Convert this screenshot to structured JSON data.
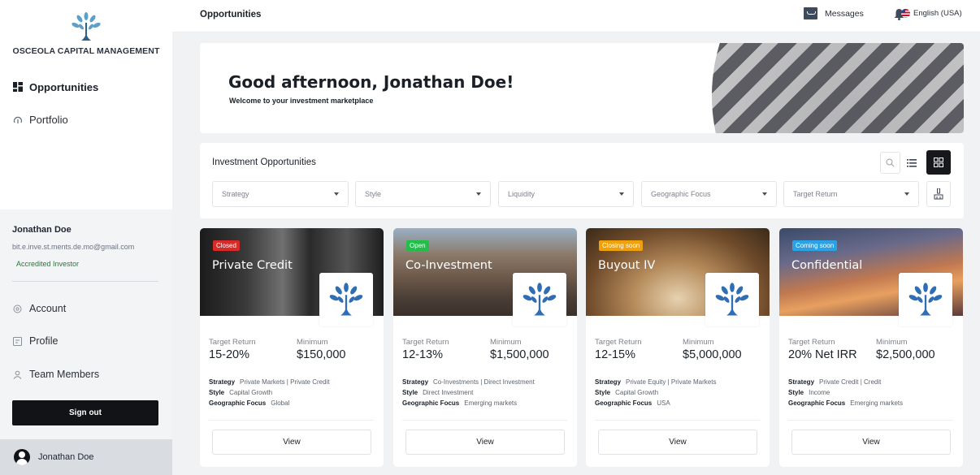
{
  "app": {
    "brand": "OSCEOLA CAPITAL MANAGEMENT"
  },
  "sidebar": {
    "nav": [
      {
        "label": "Opportunities",
        "icon": "dashboard-icon",
        "active": true
      },
      {
        "label": "Portfolio",
        "icon": "portfolio-icon",
        "active": false
      }
    ],
    "user": {
      "name": "Jonathan Doe",
      "email": "bit.e.inve.st.ments.de.mo@gmail.com",
      "badge": "Accredited Investor"
    },
    "menu": [
      {
        "label": "Account",
        "icon": "account-icon"
      },
      {
        "label": "Profile",
        "icon": "profile-icon"
      },
      {
        "label": "Team Members",
        "icon": "team-icon"
      }
    ],
    "sign_out": "Sign out",
    "footer_name": "Jonathan Doe"
  },
  "topbar": {
    "title": "Opportunities",
    "messages": "Messages",
    "language": "English (USA)"
  },
  "hero": {
    "greeting": "Good afternoon, Jonathan Doe!",
    "subtitle": "Welcome to your investment marketplace"
  },
  "investments": {
    "title": "Investment Opportunities",
    "filters": [
      "Strategy",
      "Style",
      "Liquidity",
      "Geographic Focus",
      "Target Return"
    ],
    "view_mode": "grid"
  },
  "cards": [
    {
      "badge": "Closed",
      "badge_color": "#d92a2a",
      "title": "Private Credit",
      "target_return_label": "Target Return",
      "target_return": "15-20%",
      "minimum_label": "Minimum",
      "minimum": "$150,000",
      "strategy_label": "Strategy",
      "strategy": "Private Markets | Private Credit",
      "style_label": "Style",
      "style": "Capital Growth",
      "geo_label": "Geographic Focus",
      "geo": "Global",
      "view": "View"
    },
    {
      "badge": "Open",
      "badge_color": "#1fbf4a",
      "title": "Co-Investment",
      "target_return_label": "Target Return",
      "target_return": "12-13%",
      "minimum_label": "Minimum",
      "minimum": "$1,500,000",
      "strategy_label": "Strategy",
      "strategy": "Co-Investments | Direct Investment",
      "style_label": "Style",
      "style": "Direct Investment",
      "geo_label": "Geographic Focus",
      "geo": "Emerging markets",
      "view": "View"
    },
    {
      "badge": "Closing soon",
      "badge_color": "#f0a10a",
      "title": "Buyout IV",
      "target_return_label": "Target Return",
      "target_return": "12-15%",
      "minimum_label": "Minimum",
      "minimum": "$5,000,000",
      "strategy_label": "Strategy",
      "strategy": "Private Equity | Private Markets",
      "style_label": "Style",
      "style": "Capital Growth",
      "geo_label": "Geographic Focus",
      "geo": "USA",
      "view": "View"
    },
    {
      "badge": "Coming soon",
      "badge_color": "#29a3e6",
      "title": "Confidential",
      "target_return_label": "Target Return",
      "target_return": "20% Net IRR",
      "minimum_label": "Minimum",
      "minimum": "$2,500,000",
      "strategy_label": "Strategy",
      "strategy": "Private Credit | Credit",
      "style_label": "Style",
      "style": "Income",
      "geo_label": "Geographic Focus",
      "geo": "Emerging markets",
      "view": "View"
    }
  ],
  "colors": {
    "accent_dark": "#111317",
    "tree_blue": "#2f6db5",
    "open_green": "#1fbf4a"
  }
}
